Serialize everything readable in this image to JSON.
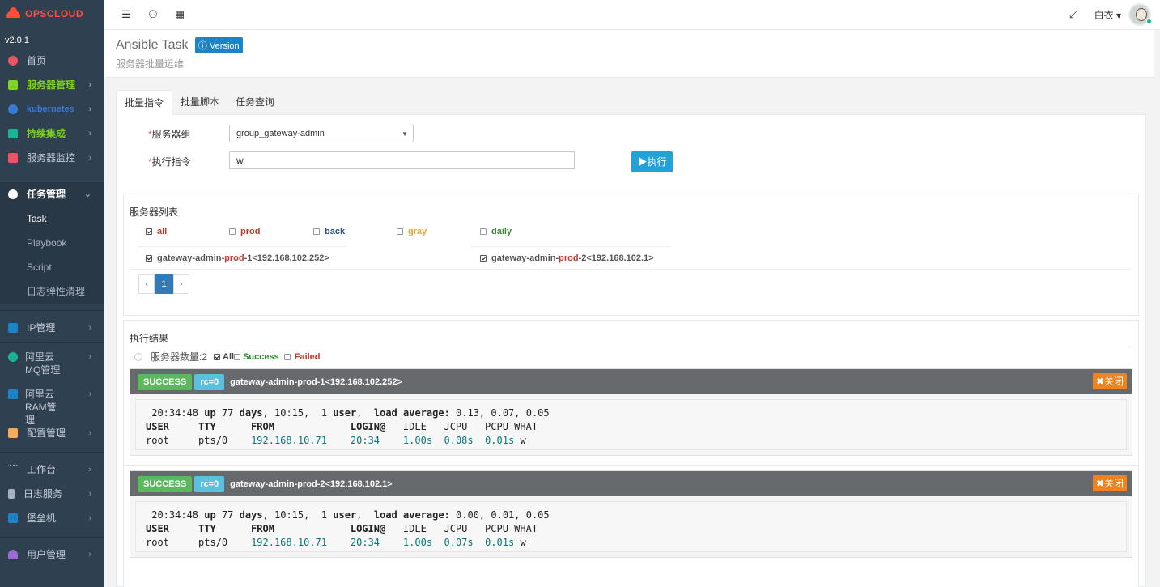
{
  "app": {
    "brand": "OPSCLOUD",
    "version": "v2.0.1"
  },
  "sidebar": {
    "items": [
      {
        "label": "首页",
        "color": "#ed5565"
      },
      {
        "label": "服务器管理",
        "color": "#7fd322",
        "text_color": "#7fd322"
      },
      {
        "label": "kubernetes",
        "color": "#3a7bd5",
        "text_color": "#3a7bd5"
      },
      {
        "label": "持续集成",
        "color": "#1ab394",
        "text_color": "#7fd322"
      },
      {
        "label": "服务器监控",
        "color": "#ed5565"
      },
      {
        "label": "任务管理",
        "color": "#ffffff"
      },
      {
        "label": "IP管理",
        "color": "#1c84c6"
      },
      {
        "label": "阿里云MQ管理",
        "color": "#1ab394"
      },
      {
        "label": "阿里云RAM管理",
        "color": "#1c84c6"
      },
      {
        "label": "配置管理",
        "color": "#f8ac59"
      },
      {
        "label": "工作台",
        "color": "#a7b1c2"
      },
      {
        "label": "日志服务",
        "color": "#a7b1c2"
      },
      {
        "label": "堡垒机",
        "color": "#1c84c6"
      },
      {
        "label": "用户管理",
        "color": "#9b6bd3"
      }
    ],
    "task_sub": [
      "Task",
      "Playbook",
      "Script",
      "日志弹性清理"
    ]
  },
  "topbar": {
    "user": "白衣"
  },
  "page": {
    "title": "Ansible Task",
    "version_btn": "Version",
    "subtitle": "服务器批量运维"
  },
  "tabs": [
    "批量指令",
    "批量脚本",
    "任务查询"
  ],
  "form": {
    "group_label": "服务器组",
    "group_value": "group_gateway-admin",
    "command_label": "执行指令",
    "command_value": "w",
    "exec_button": "▶执行"
  },
  "server_list": {
    "title": "服务器列表",
    "tags": [
      {
        "label": "all",
        "color": "#c0392b",
        "checked": true
      },
      {
        "label": "prod",
        "color": "#c0392b",
        "checked": false
      },
      {
        "label": "back",
        "color": "#2c4f7c",
        "checked": false
      },
      {
        "label": "gray",
        "color": "#e6a23c",
        "checked": false
      },
      {
        "label": "daily",
        "color": "#3c8a3c",
        "checked": false
      }
    ],
    "servers": [
      {
        "prefix": "gateway-admin-",
        "env": "prod",
        "suffix": "-1<192.168.102.252>"
      },
      {
        "prefix": "gateway-admin-",
        "env": "prod",
        "suffix": "-2<192.168.102.1>"
      }
    ],
    "pager": {
      "prev": "‹",
      "page": "1",
      "next": "›"
    }
  },
  "result": {
    "title": "执行结果",
    "server_count": "服务器数量:2",
    "filter_all": "All",
    "filter_success": "Success",
    "filter_failed": "Failed",
    "cards": [
      {
        "status": "SUCCESS",
        "rc": "rc=0",
        "host": "gateway-admin-prod-1<192.168.102.252>",
        "close": "✖关闭",
        "uptime": {
          "time": "20:34:48",
          "days": "77",
          "hm": "10:15",
          "users": "1",
          "load": "0.13, 0.07, 0.05"
        },
        "row": {
          "user": "root",
          "tty": "pts/0",
          "from": "192.168.10.71",
          "login": "20:34",
          "idle": "1.00s",
          "jcpu": "0.08s",
          "pcpu": "0.01s",
          "what": "w"
        }
      },
      {
        "status": "SUCCESS",
        "rc": "rc=0",
        "host": "gateway-admin-prod-2<192.168.102.1>",
        "close": "✖关闭",
        "uptime": {
          "time": "20:34:48",
          "days": "77",
          "hm": "10:15",
          "users": "1",
          "load": "0.00, 0.01, 0.05"
        },
        "row": {
          "user": "root",
          "tty": "pts/0",
          "from": "192.168.10.71",
          "login": "20:34",
          "idle": "1.00s",
          "jcpu": "0.07s",
          "pcpu": "0.01s",
          "what": "w"
        }
      }
    ]
  }
}
